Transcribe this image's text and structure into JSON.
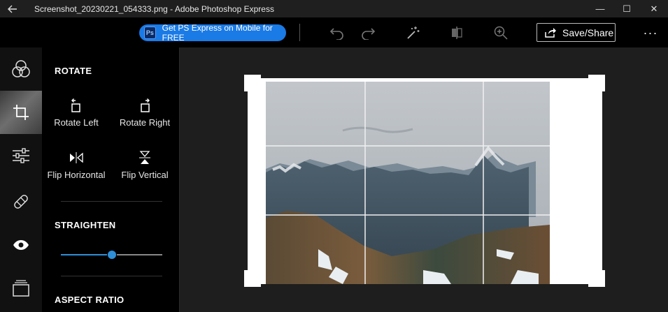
{
  "window": {
    "title": "Screenshot_20230221_054333.png - Adobe Photoshop Express",
    "back_icon": "back-arrow-icon",
    "minimize": "—",
    "maximize": "☐",
    "close": "✕"
  },
  "toolbar": {
    "promo_label": "Get PS Express on Mobile for FREE",
    "promo_icon_text": "Ps",
    "save_label": "Save/Share",
    "more_label": "···"
  },
  "panel": {
    "rotate_title": "ROTATE",
    "rotate_left": "Rotate Left",
    "rotate_right": "Rotate Right",
    "flip_horizontal": "Flip Horizontal",
    "flip_vertical": "Flip Vertical",
    "straighten_title": "STRAIGHTEN",
    "straighten_value": 0.5,
    "aspect_title": "ASPECT RATIO"
  },
  "colors": {
    "accent": "#1a7ae6",
    "slider": "#2f8fd8",
    "background": "#1e1e1e"
  }
}
